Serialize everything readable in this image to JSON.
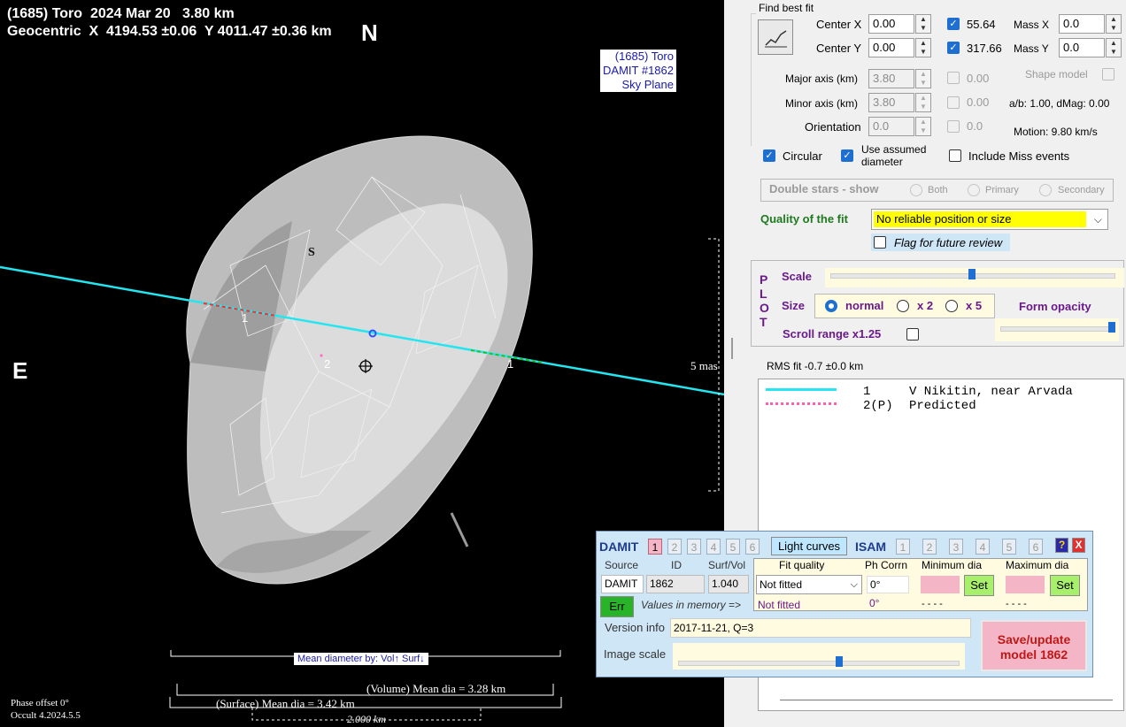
{
  "plot": {
    "title_line1": "(1685) Toro  2024 Mar 20   3.80 km",
    "title_line2": "Geocentric  X  4194.53 ±0.06  Y 4011.47 ±0.36 km",
    "north": "N",
    "east": "E",
    "damit_label": [
      "(1685) Toro",
      "DAMIT #1862",
      "Sky Plane"
    ],
    "scale_label": "5 mas",
    "s_marker": "S",
    "chord_labels": [
      "1",
      "2",
      "1"
    ],
    "mean_dia_box": "Mean diameter by: Vol↑ Surf↓",
    "volume_label": "(Volume) Mean dia = 3.28 km",
    "surface_label": "(Surface) Mean dia = 3.42 km",
    "km_label": "2.000 km",
    "phase_offset": "Phase offset 0°",
    "version": "Occult 4.2024.5.5"
  },
  "fit": {
    "group_title": "Find best fit",
    "center_x_label": "Center X",
    "center_x": "0.00",
    "center_y_label": "Center Y",
    "center_y": "0.00",
    "val_x": "55.64",
    "val_y": "317.66",
    "mass_x_label": "Mass X",
    "mass_x": "0.0",
    "mass_y_label": "Mass Y",
    "mass_y": "0.0",
    "major_label": "Major axis (km)",
    "major": "3.80",
    "major_chk": "0.00",
    "minor_label": "Minor axis (km)",
    "minor": "3.80",
    "minor_chk": "0.00",
    "orient_label": "Orientation",
    "orient": "0.0",
    "orient_chk": "0.0",
    "shape_model": "Shape model",
    "ab_text": "a/b: 1.00, dMag: 0.00",
    "motion_text": "Motion: 9.80 km/s",
    "circular": "Circular",
    "use_assumed": "Use assumed diameter",
    "include_miss": "Include Miss events",
    "double_stars": "Double stars - show",
    "both": "Both",
    "primary": "Primary",
    "secondary": "Secondary",
    "quality_label": "Quality of the fit",
    "quality_value": "No reliable position or size",
    "flag_review": "Flag for future review"
  },
  "plotopts": {
    "plot_vertical": "PLOT",
    "scale": "Scale",
    "size": "Size",
    "normal": "normal",
    "x2": "x 2",
    "x5": "x 5",
    "form_opacity": "Form opacity",
    "scroll_range": "Scroll range x1.25"
  },
  "rms": "RMS fit -0.7 ±0.0 km",
  "legend": [
    {
      "num": "1",
      "name": "V Nikitin, near Arvada"
    },
    {
      "num": "2(P)",
      "name": "Predicted"
    }
  ],
  "damit": {
    "title": "DAMIT",
    "nums": [
      "1",
      "2",
      "3",
      "4",
      "5",
      "6"
    ],
    "light_curves": "Light curves",
    "isam": "ISAM",
    "isam_nums": [
      "1",
      "2",
      "3",
      "4",
      "5",
      "6"
    ],
    "help": "?",
    "close": "X",
    "hdr_source": "Source",
    "hdr_id": "ID",
    "hdr_surf": "Surf/Vol",
    "hdr_fit": "Fit quality",
    "hdr_ph": "Ph Corrn",
    "hdr_min": "Minimum dia",
    "hdr_max": "Maximum dia",
    "source": "DAMIT",
    "id": "1862",
    "surf": "1.040",
    "fit_value": "Not fitted",
    "ph": "0°",
    "set": "Set",
    "err": "Err",
    "values_mem": "Values in memory =>",
    "fit_value2": "Not fitted",
    "ph2": "0°",
    "dashes": "- - - -",
    "version_label": "Version info",
    "version_value": "2017-11-21, Q=3",
    "image_scale": "Image scale",
    "save_btn": "Save/update model 1862"
  }
}
